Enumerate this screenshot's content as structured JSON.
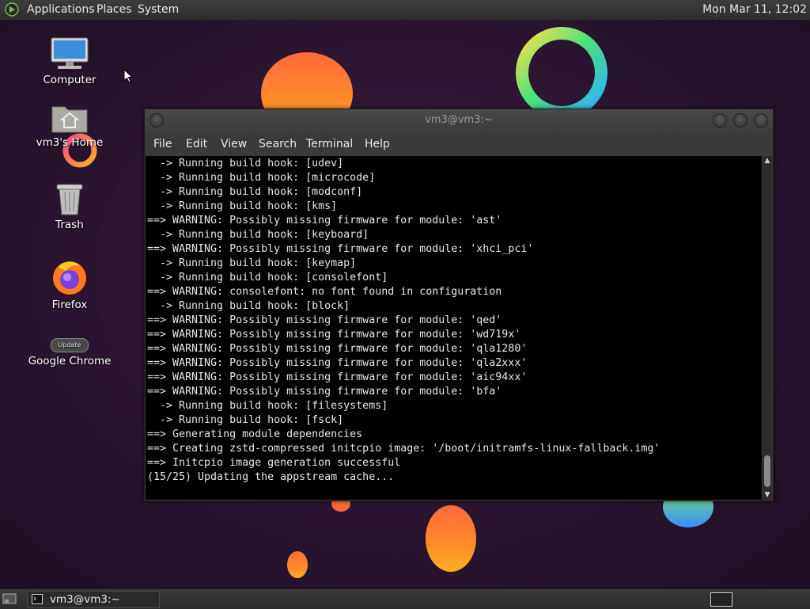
{
  "top_panel": {
    "menus": [
      "Applications",
      "Places",
      "System"
    ],
    "clock": "Mon Mar 11, 12:02"
  },
  "desktop": {
    "icons": [
      {
        "label": "Computer",
        "icon": "computer-icon"
      },
      {
        "label": "vm3's Home",
        "icon": "home-folder-icon"
      },
      {
        "label": "Trash",
        "icon": "trash-icon"
      },
      {
        "label": "Firefox",
        "icon": "firefox-icon"
      },
      {
        "label": "Google Chrome",
        "icon": "chrome-update-icon",
        "badge": "Update"
      }
    ]
  },
  "terminal": {
    "title": "vm3@vm3:~",
    "menus": [
      "File",
      "Edit",
      "View",
      "Search",
      "Terminal",
      "Help"
    ],
    "lines": [
      "  -> Running build hook: [udev]",
      "  -> Running build hook: [microcode]",
      "  -> Running build hook: [modconf]",
      "  -> Running build hook: [kms]",
      "==> WARNING: Possibly missing firmware for module: 'ast'",
      "  -> Running build hook: [keyboard]",
      "==> WARNING: Possibly missing firmware for module: 'xhci_pci'",
      "  -> Running build hook: [keymap]",
      "  -> Running build hook: [consolefont]",
      "==> WARNING: consolefont: no font found in configuration",
      "  -> Running build hook: [block]",
      "==> WARNING: Possibly missing firmware for module: 'qed'",
      "==> WARNING: Possibly missing firmware for module: 'wd719x'",
      "==> WARNING: Possibly missing firmware for module: 'qla1280'",
      "==> WARNING: Possibly missing firmware for module: 'qla2xxx'",
      "==> WARNING: Possibly missing firmware for module: 'aic94xx'",
      "==> WARNING: Possibly missing firmware for module: 'bfa'",
      "  -> Running build hook: [filesystems]",
      "  -> Running build hook: [fsck]",
      "==> Generating module dependencies",
      "==> Creating zstd-compressed initcpio image: '/boot/initramfs-linux-fallback.img'",
      "==> Initcpio image generation successful",
      "(15/25) Updating the appstream cache..."
    ]
  },
  "bottom_panel": {
    "task_label": "vm3@vm3:~"
  },
  "colors": {
    "wallpaper": "#2a1530",
    "terminal_bg": "#000000",
    "terminal_fg": "#e8e8e8"
  }
}
